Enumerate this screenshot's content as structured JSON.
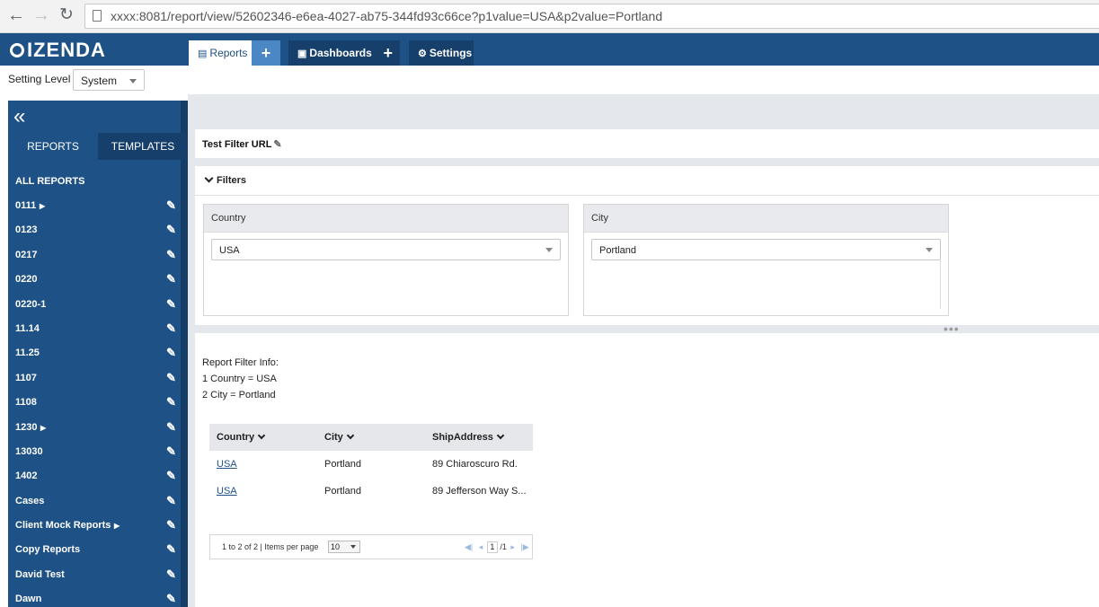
{
  "browser": {
    "url": "xxxx:8081/report/view/52602346-e6ea-4027-ab75-344fd93c66ce?p1value=USA&p2value=Portland"
  },
  "header": {
    "logo": "IZENDA",
    "tabs": {
      "reports": "Reports",
      "dashboards": "Dashboards",
      "settings": "Settings"
    }
  },
  "setting_level": {
    "label": "Setting Level",
    "value": "System"
  },
  "sidebar": {
    "tabs": [
      "REPORTS",
      "TEMPLATES"
    ],
    "all_reports": "ALL REPORTS",
    "items": [
      {
        "label": "0111",
        "has_children": true
      },
      {
        "label": "0123",
        "has_children": false
      },
      {
        "label": "0217",
        "has_children": false
      },
      {
        "label": "0220",
        "has_children": false
      },
      {
        "label": "0220-1",
        "has_children": false
      },
      {
        "label": "11.14",
        "has_children": false
      },
      {
        "label": "11.25",
        "has_children": false
      },
      {
        "label": "1107",
        "has_children": false
      },
      {
        "label": "1108",
        "has_children": false
      },
      {
        "label": "1230",
        "has_children": true
      },
      {
        "label": "13030",
        "has_children": false
      },
      {
        "label": "1402",
        "has_children": false
      },
      {
        "label": "Cases",
        "has_children": false
      },
      {
        "label": "Client Mock Reports",
        "has_children": true
      },
      {
        "label": "Copy Reports",
        "has_children": false
      },
      {
        "label": "David Test",
        "has_children": false
      },
      {
        "label": "Dawn",
        "has_children": false
      }
    ]
  },
  "report": {
    "title": "Test Filter URL",
    "filters": {
      "header": "Filters",
      "country": {
        "label": "Country",
        "value": "USA"
      },
      "city": {
        "label": "City",
        "value": "Portland"
      }
    },
    "filter_info": {
      "heading": "Report Filter Info:",
      "lines": [
        "1 Country = USA",
        "2 City = Portland"
      ]
    },
    "grid": {
      "columns": [
        "Country",
        "City",
        "ShipAddress"
      ],
      "rows": [
        [
          "USA",
          "Portland",
          "89 Chiaroscuro Rd."
        ],
        [
          "USA",
          "Portland",
          "89 Jefferson Way S..."
        ]
      ]
    },
    "pager": {
      "info": "1 to 2 of 2 | Items per page",
      "per_page": "10",
      "page": "1",
      "total": "/1"
    }
  },
  "colors": {
    "brand": "#1e5185",
    "brand_dark": "#16406b",
    "accent": "#4a87c4"
  }
}
